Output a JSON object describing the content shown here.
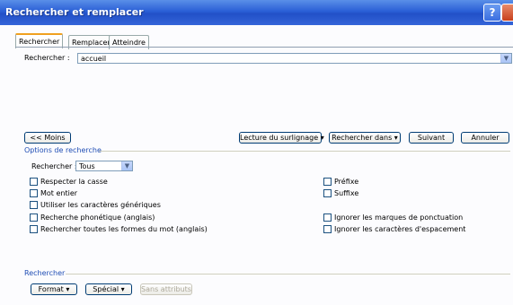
{
  "window": {
    "title": "Rechercher et remplacer",
    "help_label": "?"
  },
  "tabs": [
    {
      "label": "Rechercher"
    },
    {
      "label": "Remplacer"
    },
    {
      "label": "Atteindre"
    }
  ],
  "search": {
    "label": "Rechercher :",
    "value": "accueil"
  },
  "buttons": {
    "less": "<< Moins",
    "reading_highlight": "Lecture du surlignage",
    "find_in": "Rechercher dans",
    "next": "Suivant",
    "cancel": "Annuler",
    "format": "Format",
    "special": "Spécial",
    "no_format": "Sans attributs"
  },
  "options": {
    "section_label": "Options de recherche",
    "direction_label": "Rechercher :",
    "direction_value": "Tous",
    "left": [
      {
        "label": "Respecter la casse",
        "checked": false
      },
      {
        "label": "Mot entier",
        "checked": false
      },
      {
        "label": "Utiliser les caractères génériques",
        "checked": false
      },
      {
        "label": "Recherche phonétique (anglais)",
        "checked": false
      },
      {
        "label": "Rechercher toutes les formes du mot (anglais)",
        "checked": false
      }
    ],
    "right_top": [
      {
        "label": "Préfixe",
        "checked": false
      },
      {
        "label": "Suffixe",
        "checked": false
      }
    ],
    "right_bottom": [
      {
        "label": "Ignorer les marques de ponctuation",
        "checked": false
      },
      {
        "label": "Ignorer les caractères d'espacement",
        "checked": false
      }
    ]
  },
  "find_section": {
    "label": "Rechercher"
  },
  "colors": {
    "title_bar": "#2a5fd6",
    "section_text": "#1f4db4",
    "accent_tab": "#f0a020"
  }
}
